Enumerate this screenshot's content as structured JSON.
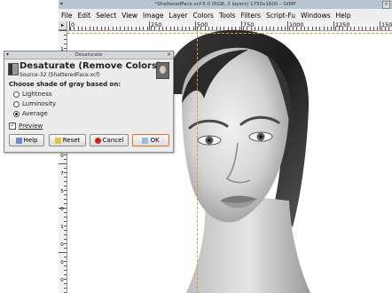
{
  "window": {
    "title": "*ShatteredFace.xcf-5.0 (RGB, 2 layers) 1750x1600 – GIMP"
  },
  "menubar": {
    "items": [
      "File",
      "Edit",
      "Select",
      "View",
      "Image",
      "Layer",
      "Colors",
      "Tools",
      "Filters",
      "Script-Fu",
      "Windows",
      "Help"
    ]
  },
  "ruler": {
    "h_labels": [
      "0",
      "250",
      "500",
      "750",
      "1000",
      "1250",
      "1500"
    ],
    "v_labels": [
      "1",
      "2",
      "5",
      "0",
      "5",
      "0",
      "0",
      "7",
      "5",
      "0",
      "1",
      "0",
      "0",
      "0"
    ]
  },
  "dialog": {
    "window_title": "Desaturate",
    "heading": "Desaturate (Remove Colors)",
    "subtitle": "Source-32 (ShatteredFace.xcf)",
    "question": "Choose shade of gray based on:",
    "options": [
      "Lightness",
      "Luminosity",
      "Average"
    ],
    "selected_option": "Average",
    "preview_label": "Preview",
    "preview_checked": true,
    "buttons": {
      "help": "Help",
      "reset": "Reset",
      "cancel": "Cancel",
      "ok": "OK"
    }
  },
  "colors": {
    "guide": "#c8a23a",
    "ok_border": "#e07020",
    "cancel_icon": "#d02020"
  }
}
